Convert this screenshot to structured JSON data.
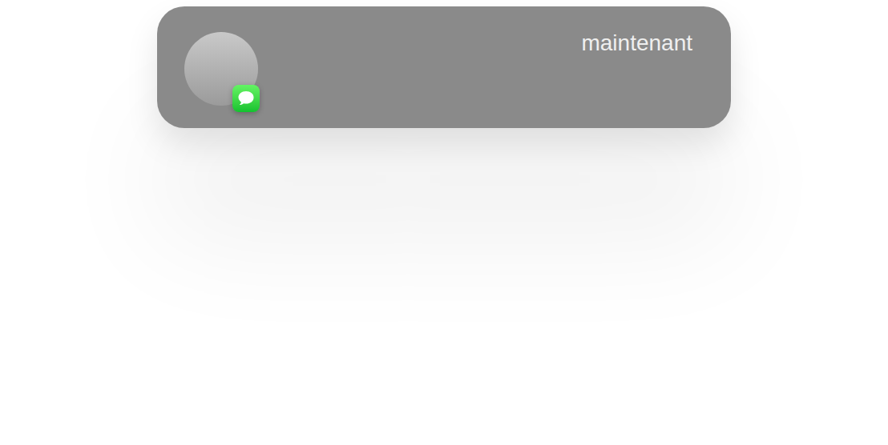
{
  "notification": {
    "time": "maintenant"
  }
}
